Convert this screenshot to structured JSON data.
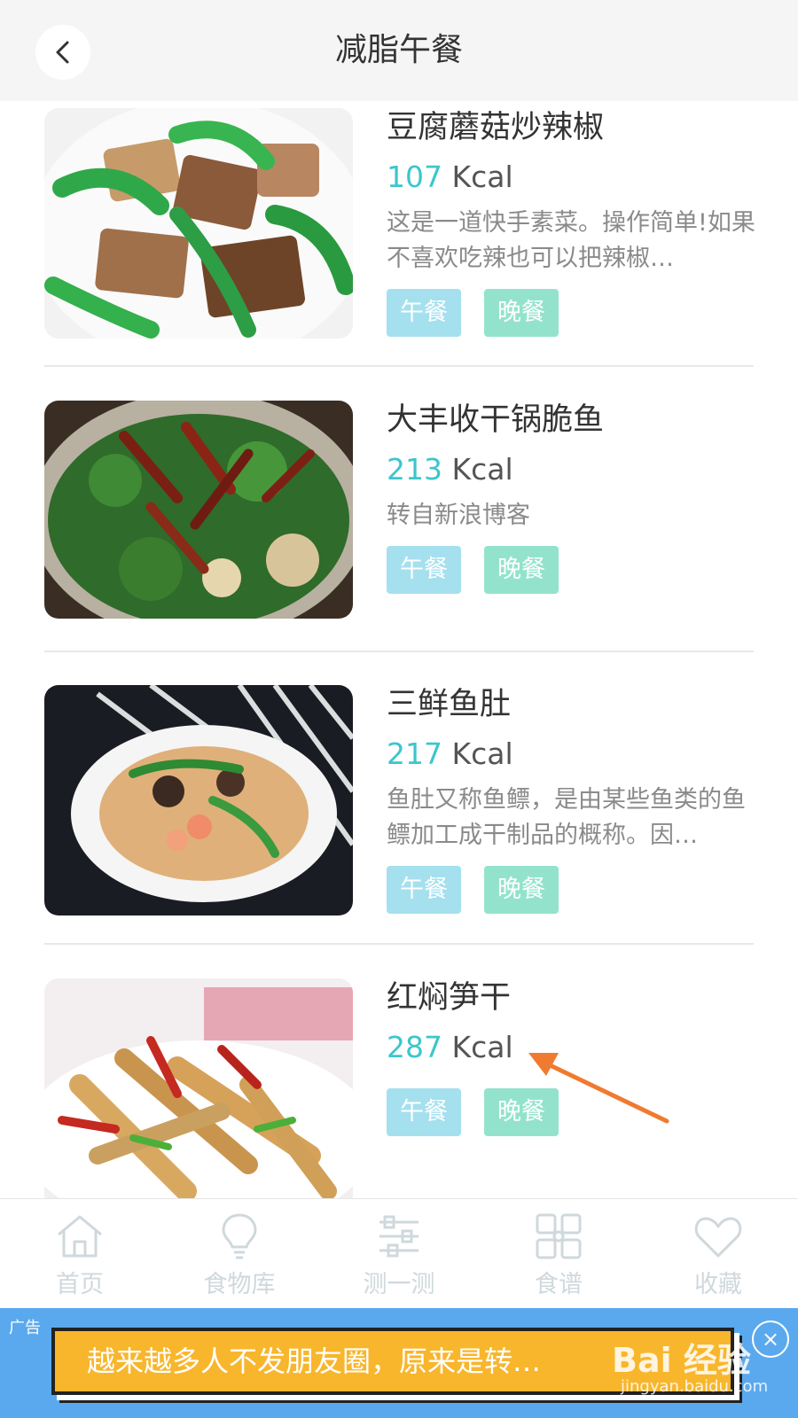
{
  "header": {
    "title": "减脂午餐",
    "back_icon": "chevron-left-icon"
  },
  "items": [
    {
      "name": "豆腐蘑菇炒辣椒",
      "kcal": "107",
      "unit": " Kcal",
      "desc": "这是一道快手素菜。操作简单!如果不喜欢吃辣也可以把辣椒…",
      "tags": [
        "午餐",
        "晚餐"
      ]
    },
    {
      "name": "大丰收干锅脆鱼",
      "kcal": "213",
      "unit": " Kcal",
      "desc": "转自新浪博客",
      "tags": [
        "午餐",
        "晚餐"
      ]
    },
    {
      "name": "三鲜鱼肚",
      "kcal": "217",
      "unit": " Kcal",
      "desc": "鱼肚又称鱼鳔，是由某些鱼类的鱼鳔加工成干制品的概称。因…",
      "tags": [
        "午餐",
        "晚餐"
      ]
    },
    {
      "name": "红焖笋干",
      "kcal": "287",
      "unit": " Kcal",
      "desc": "",
      "tags": [
        "午餐",
        "晚餐"
      ]
    }
  ],
  "tabbar": [
    {
      "label": "首页",
      "icon": "home-icon"
    },
    {
      "label": "食物库",
      "icon": "lightbulb-icon"
    },
    {
      "label": "测一测",
      "icon": "sliders-icon"
    },
    {
      "label": "食谱",
      "icon": "grid-icon"
    },
    {
      "label": "收藏",
      "icon": "heart-icon"
    }
  ],
  "ad": {
    "label": "广告",
    "text": "越来越多人不发朋友圈，原来是转…",
    "close": "×"
  },
  "watermark": {
    "brand": "Bai 经验",
    "url": "jingyan.baidu.com"
  },
  "colors": {
    "accent": "#3cc6cd",
    "tag_lunch": "#a5e0ee",
    "tag_dinner": "#93e3cc",
    "ad_bg": "#5aa9ee"
  }
}
